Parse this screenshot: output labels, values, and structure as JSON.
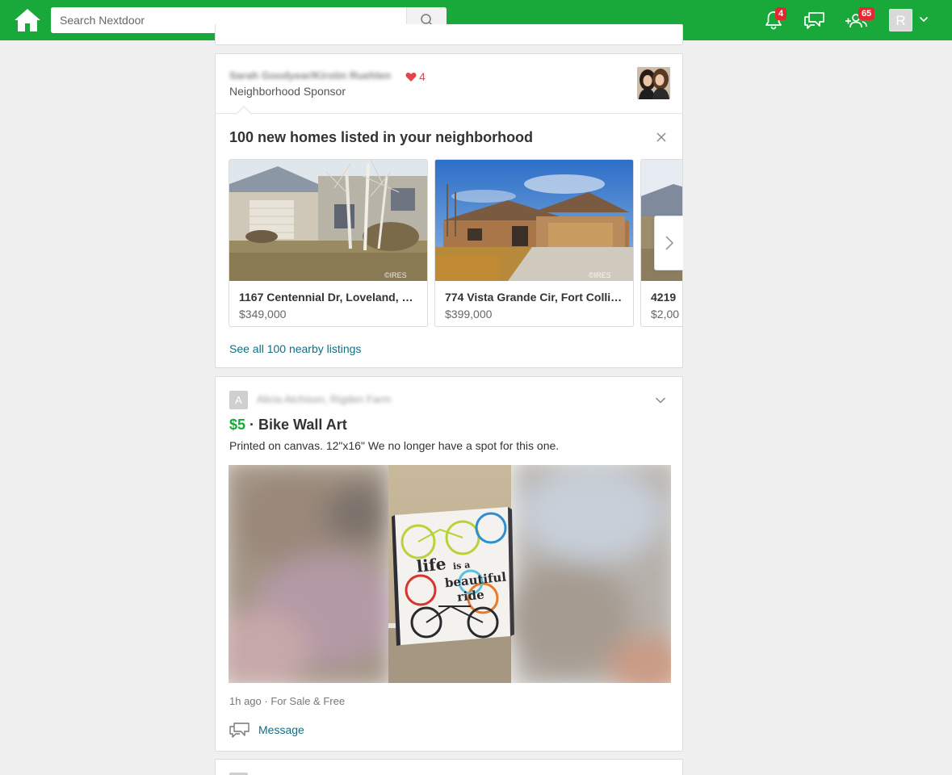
{
  "header": {
    "search_placeholder": "Search Nextdoor",
    "notifications_count": "4",
    "neighbors_count": "65",
    "avatar_initial": "R",
    "brand_color": "#19a83a",
    "badge_color": "#e3292f"
  },
  "sponsor_card": {
    "sponsor_name": "Sarah Goodyear/Kirstin Ruehlen",
    "hearts": "4",
    "subtitle": "Neighborhood Sponsor",
    "title": "100 new homes listed in your neighborhood",
    "listings": [
      {
        "address": "1167 Centennial Dr, Loveland, C...",
        "price": "$349,000"
      },
      {
        "address": "774 Vista Grande Cir, Fort Collin...",
        "price": "$399,000"
      },
      {
        "address": "4219 ",
        "price": "$2,00"
      }
    ],
    "see_all": "See all 100 nearby listings"
  },
  "post": {
    "avatar_initial": "A",
    "author": "Alicia Atchison, Rigden Farm",
    "price": "$5",
    "separator": " · ",
    "title": "Bike Wall Art",
    "body": "Printed on canvas. 12\"x16\" We no longer have a spot for this one.",
    "canvas_text_1": "life",
    "canvas_text_2": "is a",
    "canvas_text_3": "beautiful",
    "canvas_text_4": "ride",
    "meta": "1h ago · For Sale & Free",
    "message_label": "Message"
  }
}
